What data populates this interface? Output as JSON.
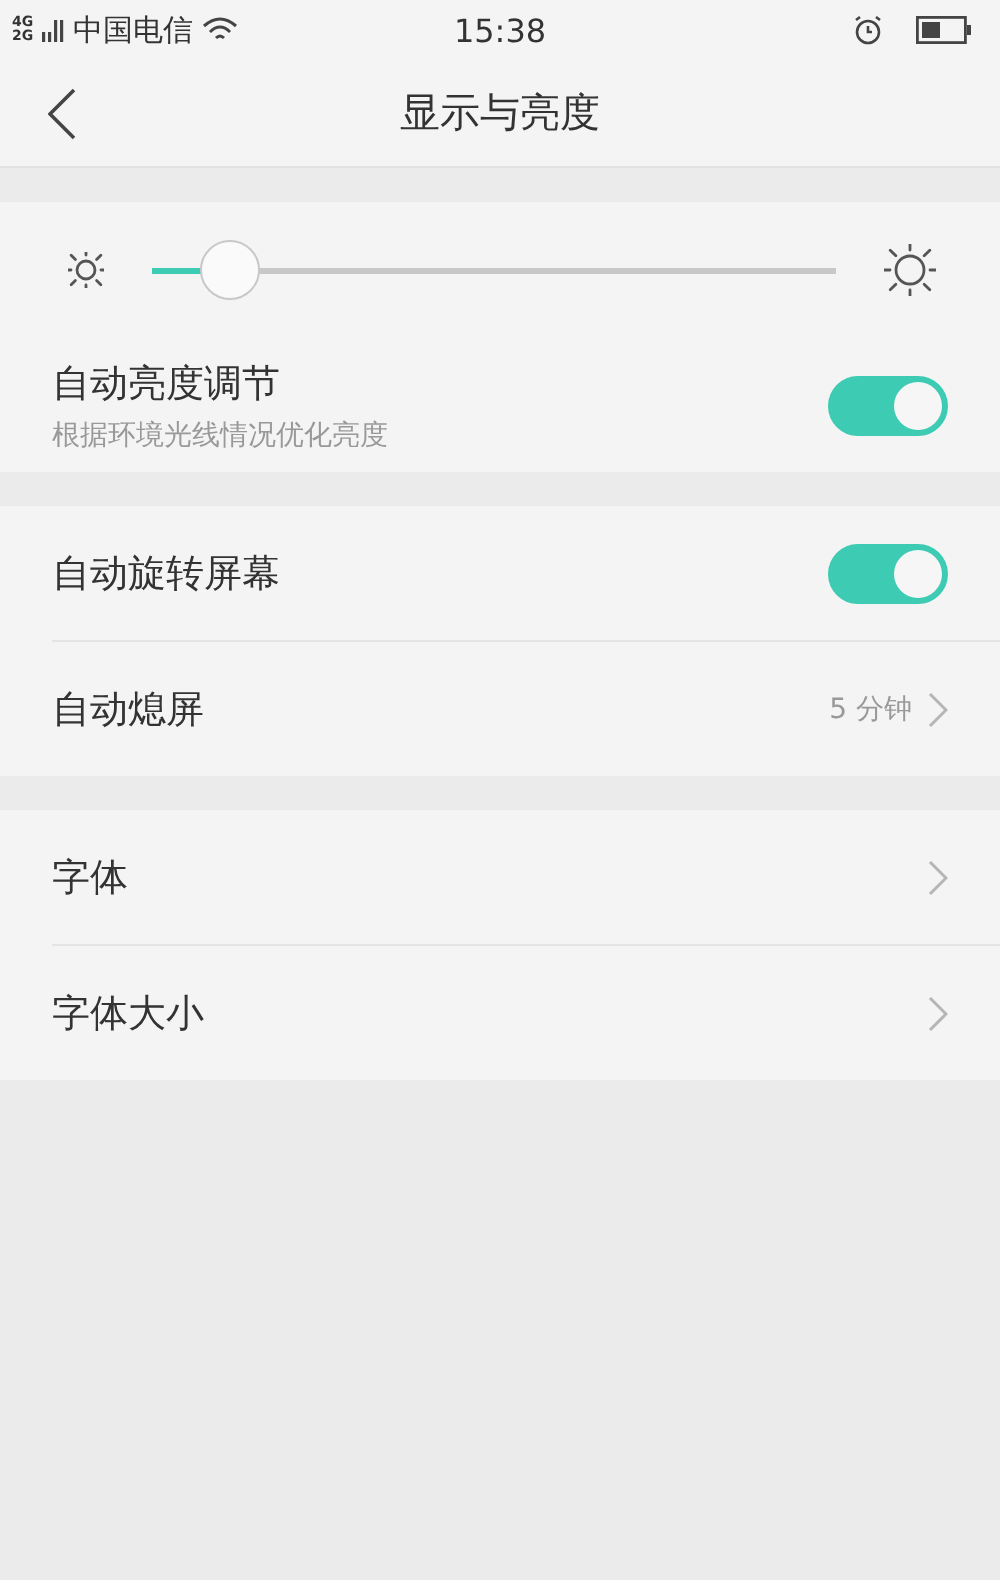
{
  "status_bar": {
    "network": [
      "4G",
      "2G"
    ],
    "carrier": "中国电信",
    "time": "15:38"
  },
  "header": {
    "title": "显示与亮度"
  },
  "sections": [
    {
      "brightness": {
        "level": 0.11
      },
      "items": [
        {
          "kind": "toggle",
          "label": "自动亮度调节",
          "subtitle": "根据环境光线情况优化亮度",
          "on": true
        }
      ]
    },
    {
      "items": [
        {
          "kind": "toggle",
          "label": "自动旋转屏幕",
          "on": true
        },
        {
          "kind": "link",
          "label": "自动熄屏",
          "value": "5 分钟"
        }
      ]
    },
    {
      "items": [
        {
          "kind": "link",
          "label": "字体"
        },
        {
          "kind": "link",
          "label": "字体大小"
        }
      ]
    }
  ]
}
